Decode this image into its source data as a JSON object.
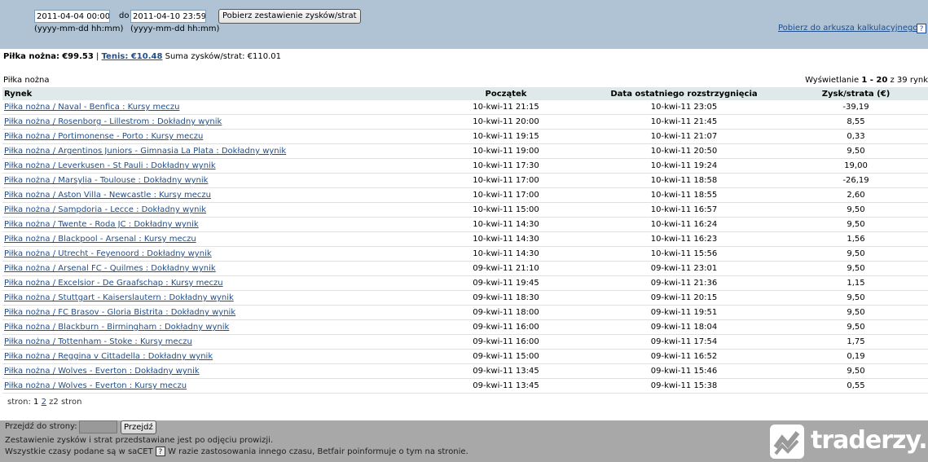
{
  "filter": {
    "date_from": "2011-04-04 00:00",
    "to_label": "do",
    "date_to": "2011-04-10 23:59",
    "format_hint_from": "(yyyy-mm-dd hh:mm)",
    "format_hint_to": "(yyyy-mm-dd hh:mm)",
    "submit_label": "Pobierz zestawienie zysków/strat",
    "export_link": "Pobierz do arkusza kalkulacyjnego",
    "help_glyph": "?"
  },
  "summary": {
    "football_label": "Piłka nożna:",
    "football_value": "€99.53",
    "separator": "|",
    "tennis": "Tenis: €10.48",
    "total_label": "Suma zysków/strat:",
    "total_value": "€110.01"
  },
  "section": {
    "title": "Piłka nożna",
    "showing_prefix": "Wyświetlanie",
    "showing_range": "1 - 20",
    "showing_suffix": "z 39 rynk"
  },
  "table": {
    "headers": [
      "Rynek",
      "Początek",
      "Data ostatniego rozstrzygnięcia",
      "Zysk/strata (€)"
    ],
    "rows": [
      [
        "Piłka nożna / Naval - Benfica : Kursy meczu",
        "10-kwi-11 21:15",
        "10-kwi-11 23:05",
        "-39,19"
      ],
      [
        "Piłka nożna / Rosenborg - Lillestrom : Dokładny wynik",
        "10-kwi-11 20:00",
        "10-kwi-11 21:45",
        "8,55"
      ],
      [
        "Piłka nożna / Portimonense - Porto : Kursy meczu",
        "10-kwi-11 19:15",
        "10-kwi-11 21:07",
        "0,33"
      ],
      [
        "Piłka nożna / Argentinos Juniors - Gimnasia La Plata : Dokładny wynik",
        "10-kwi-11 19:00",
        "10-kwi-11 20:50",
        "9,50"
      ],
      [
        "Piłka nożna / Leverkusen - St Pauli : Dokładny wynik",
        "10-kwi-11 17:30",
        "10-kwi-11 19:24",
        "19,00"
      ],
      [
        "Piłka nożna / Marsylia - Toulouse : Dokładny wynik",
        "10-kwi-11 17:00",
        "10-kwi-11 18:58",
        "-26,19"
      ],
      [
        "Piłka nożna / Aston Villa - Newcastle : Kursy meczu",
        "10-kwi-11 17:00",
        "10-kwi-11 18:55",
        "2,60"
      ],
      [
        "Piłka nożna / Sampdoria - Lecce : Dokładny wynik",
        "10-kwi-11 15:00",
        "10-kwi-11 16:57",
        "9,50"
      ],
      [
        "Piłka nożna / Twente - Roda JC : Dokładny wynik",
        "10-kwi-11 14:30",
        "10-kwi-11 16:24",
        "9,50"
      ],
      [
        "Piłka nożna / Blackpool - Arsenal : Kursy meczu",
        "10-kwi-11 14:30",
        "10-kwi-11 16:23",
        "1,56"
      ],
      [
        "Piłka nożna / Utrecht - Feyenoord : Dokładny wynik",
        "10-kwi-11 14:30",
        "10-kwi-11 15:56",
        "9,50"
      ],
      [
        "Piłka nożna / Arsenal FC - Quilmes : Dokładny wynik",
        "09-kwi-11 21:10",
        "09-kwi-11 23:01",
        "9,50"
      ],
      [
        "Piłka nożna / Excelsior - De Graafschap : Kursy meczu",
        "09-kwi-11 19:45",
        "09-kwi-11 21:36",
        "1,15"
      ],
      [
        "Piłka nożna / Stuttgart - Kaiserslautern : Dokładny wynik",
        "09-kwi-11 18:30",
        "09-kwi-11 20:15",
        "9,50"
      ],
      [
        "Piłka nożna / FC Brasov - Gloria Bistrita : Dokładny wynik",
        "09-kwi-11 18:00",
        "09-kwi-11 19:51",
        "9,50"
      ],
      [
        "Piłka nożna / Blackburn - Birmingham : Dokładny wynik",
        "09-kwi-11 16:00",
        "09-kwi-11 18:04",
        "9,50"
      ],
      [
        "Piłka nożna / Tottenham - Stoke : Kursy meczu",
        "09-kwi-11 16:00",
        "09-kwi-11 17:54",
        "1,75"
      ],
      [
        "Piłka nożna / Reggina v Cittadella : Dokładny wynik",
        "09-kwi-11 15:00",
        "09-kwi-11 16:52",
        "0,19"
      ],
      [
        "Piłka nożna / Wolves - Everton : Dokładny wynik",
        "09-kwi-11 13:45",
        "09-kwi-11 15:46",
        "9,50"
      ],
      [
        "Piłka nożna / Wolves - Everton : Kursy meczu",
        "09-kwi-11 13:45",
        "09-kwi-11 15:38",
        "0,55"
      ]
    ]
  },
  "pager": {
    "prefix": "stron:",
    "current": "1",
    "next": "2",
    "suffix": "z2 stron"
  },
  "footer": {
    "goto_label": "Przejdź do strony:",
    "goto_button": "Przejdź",
    "note1": "Zestawienie zysków i strat przedstawiane jest po odjęciu prowizji.",
    "note2_a": "Wszystkie czasy podane są w saCET",
    "note2_q": "?",
    "note2_b": "W razie zastosowania innego czasu, Betfair poinformuje o tym na stronie."
  },
  "watermark": {
    "text": "traderzy.pl"
  }
}
